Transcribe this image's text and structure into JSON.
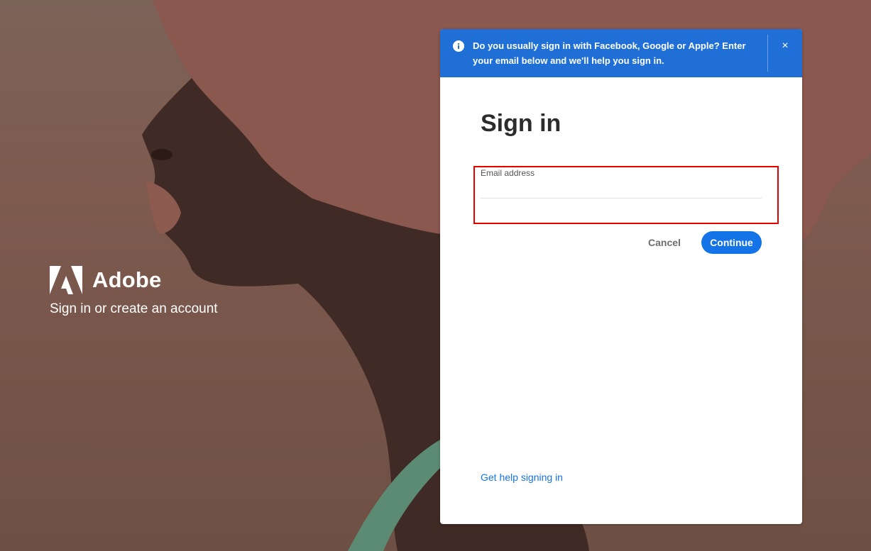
{
  "brand": {
    "name": "Adobe",
    "tagline": "Sign in or create an account",
    "logo_icon": "adobe-logo-icon"
  },
  "banner": {
    "icon": "info-icon",
    "text": "Do you usually sign in with Facebook, Google or Apple? Enter your email below and we'll help you sign in.",
    "close_label": "×",
    "color": "#1f6fd6"
  },
  "signin": {
    "title": "Sign in",
    "email_label": "Email address",
    "email_value": "",
    "cancel_label": "Cancel",
    "continue_label": "Continue",
    "help_link": "Get help signing in"
  },
  "colors": {
    "accent": "#1473e6",
    "highlight": "#e60000"
  }
}
